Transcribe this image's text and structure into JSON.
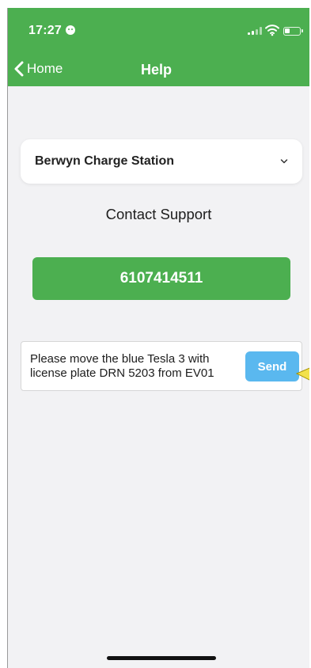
{
  "status_bar": {
    "time": "17:27",
    "face_icon": "smiley-face-icon",
    "signal_icon": "cellular-signal-icon",
    "wifi_icon": "wifi-icon",
    "battery_icon": "battery-icon"
  },
  "nav": {
    "back_label": "Home",
    "back_icon": "chevron-left-icon",
    "title": "Help"
  },
  "station_selector": {
    "selected": "Berwyn Charge Station",
    "icon": "chevron-down-icon"
  },
  "contact": {
    "label": "Contact Support",
    "phone": "6107414511"
  },
  "message": {
    "value": "Please move the blue Tesla 3 with license plate DRN 5203 from EV01",
    "send_label": "Send"
  },
  "colors": {
    "header": "#4caf50",
    "phone_button": "#4caf50",
    "send_button": "#5ab8ef",
    "background": "#f2f2f4",
    "pointer_annotation": "#f2e14b"
  }
}
